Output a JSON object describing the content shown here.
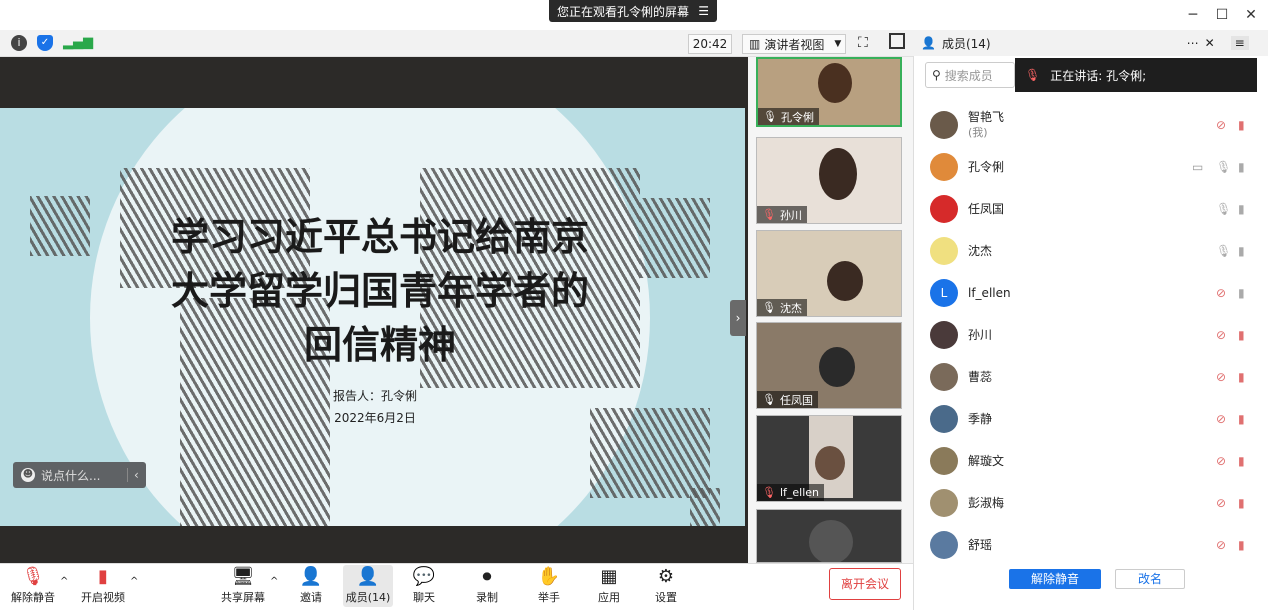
{
  "share_banner": {
    "text": "您正在观看孔令俐的屏幕",
    "menu_icon": "menu-icon"
  },
  "window_controls": [
    "minimize-icon",
    "maximize-icon",
    "close-icon"
  ],
  "topbar": {
    "time": "20:42",
    "view_label": "演讲者视图"
  },
  "slide": {
    "title_lines": [
      "学习习近平总书记给南京",
      "大学留学归国青年学者的",
      "回信精神"
    ],
    "reporter": "报告人：孔令俐",
    "date": "2022年6月2日"
  },
  "chat_placeholder": "说点什么...",
  "video_tiles": [
    {
      "name": "孔令俐",
      "muted": false
    },
    {
      "name": "孙川",
      "muted": true
    },
    {
      "name": "沈杰",
      "muted": false
    },
    {
      "name": "任凤国",
      "muted": false
    },
    {
      "name": "lf_ellen",
      "muted": true
    }
  ],
  "panel": {
    "title": "成员(14)",
    "search_placeholder": "搜索成员",
    "speaking_label": "正在讲话: 孔令俐;",
    "members": [
      {
        "name": "智艳飞",
        "sub": "(我)",
        "muted": true,
        "video_off": true,
        "avatar_color": "#6a5a4a"
      },
      {
        "name": "孔令俐",
        "sub": "",
        "muted": false,
        "video_off": false,
        "share": true,
        "avatar_color": "#e08a3a"
      },
      {
        "name": "任凤国",
        "sub": "",
        "muted": false,
        "video_off": false,
        "avatar_color": "#d62a2a"
      },
      {
        "name": "沈杰",
        "sub": "",
        "muted": false,
        "video_off": false,
        "avatar_color": "#f0e080"
      },
      {
        "name": "lf_ellen",
        "sub": "",
        "muted": true,
        "video_off": false,
        "avatar_color": "#1a73e8",
        "initial": "L"
      },
      {
        "name": "孙川",
        "sub": "",
        "muted": true,
        "video_off": true,
        "avatar_color": "#4a3a3a"
      },
      {
        "name": "曹蕊",
        "sub": "",
        "muted": true,
        "video_off": true,
        "avatar_color": "#7a6a5a"
      },
      {
        "name": "季静",
        "sub": "",
        "muted": true,
        "video_off": true,
        "avatar_color": "#4a6a8a"
      },
      {
        "name": "解璇文",
        "sub": "",
        "muted": true,
        "video_off": true,
        "avatar_color": "#8a7a5a"
      },
      {
        "name": "彭淑梅",
        "sub": "",
        "muted": true,
        "video_off": true,
        "avatar_color": "#a09070"
      },
      {
        "name": "舒瑶",
        "sub": "",
        "muted": true,
        "video_off": true,
        "avatar_color": "#5a7aa0"
      }
    ],
    "unmute_all": "解除静音",
    "rename": "改名"
  },
  "bottom": {
    "unmute": "解除静音",
    "video": "开启视频",
    "share": "共享屏幕",
    "invite": "邀请",
    "members": "成员(14)",
    "chat": "聊天",
    "record": "录制",
    "raise": "举手",
    "apps": "应用",
    "settings": "设置",
    "leave": "离开会议"
  }
}
